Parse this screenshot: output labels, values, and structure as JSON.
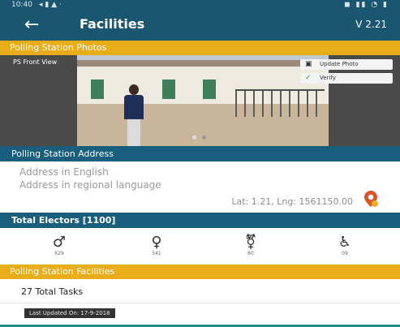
{
  "status_bar": {
    "time": "10:40",
    "left_icons": "◂ ▮ ▲ ·",
    "right_icons": "◼ ▮▮ ◔ ▮"
  },
  "app_bar": {
    "back_icon": "arrow-left-icon",
    "title": "Facilities",
    "version": "V 2.21"
  },
  "photos_section": {
    "header": "Polling Station Photos",
    "photo_label": "PS Front View",
    "update_photo_label": "Update Photo",
    "verify_label": "Verify",
    "carousel_dots": 2
  },
  "address_section": {
    "header": "Polling Station Address",
    "english_placeholder": "Address in English",
    "regional_placeholder": "Address in regional language",
    "latlng": "Lat: 1.21, Lng: 1561150.00",
    "pin_icon": "location-pin-icon"
  },
  "electors": {
    "header": "Total Electors [1100]",
    "items": [
      {
        "icon": "male-icon",
        "count": "629"
      },
      {
        "icon": "female-icon",
        "count": "541"
      },
      {
        "icon": "third-gender-icon",
        "count": "60"
      },
      {
        "icon": "wheelchair-icon",
        "count": "09"
      }
    ]
  },
  "facilities_section": {
    "header": "Polling Station Facilities",
    "total_tasks": "27 Total Tasks",
    "last_updated": "Last Updated On: 17-9-2018"
  },
  "colors": {
    "app_bar": "#1a5670",
    "yellow_header": "#e9ad1a",
    "teal_header": "#1a5e7e",
    "verify_check": "#2fa84f",
    "pin": "#d8542a"
  }
}
